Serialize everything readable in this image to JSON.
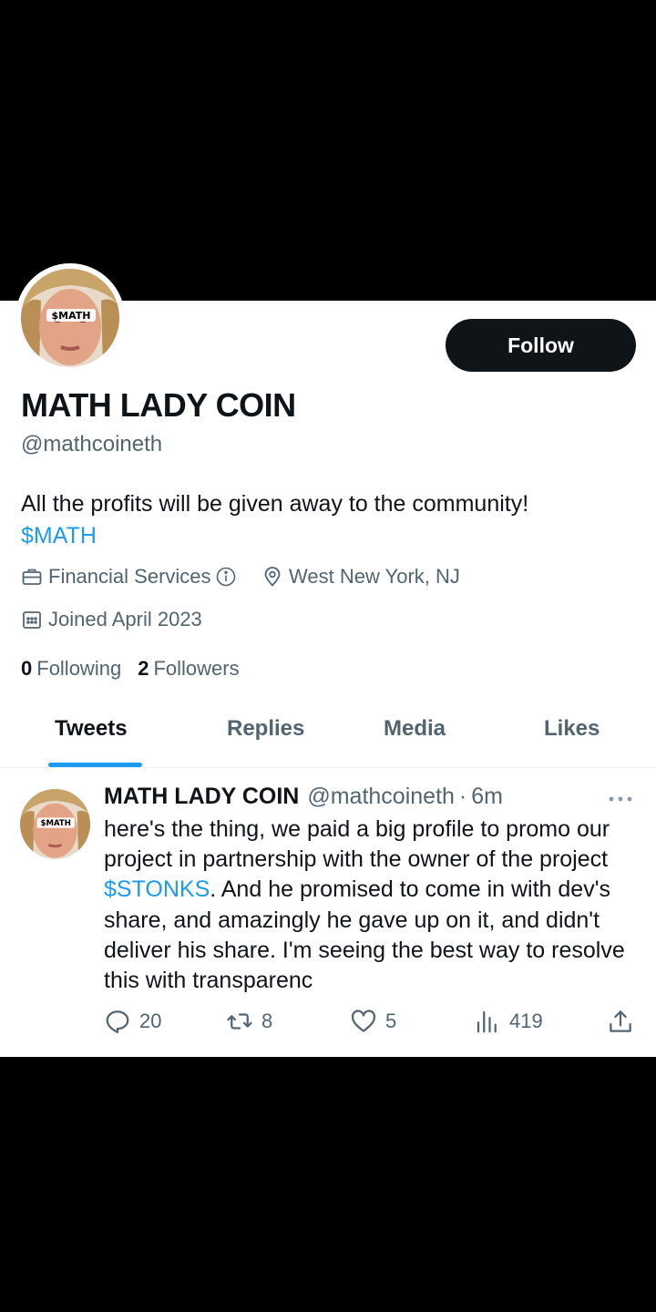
{
  "profile": {
    "display_name": "MATH LADY COIN",
    "handle": "@mathcoineth",
    "avatar_label": "$MATH",
    "follow_label": "Follow",
    "bio": "All the profits will be given away to the community!",
    "bio_tag": "$MATH",
    "category": "Financial Services",
    "location": "West New York, NJ",
    "joined": "Joined April 2023",
    "following_count": "0",
    "following_label": "Following",
    "followers_count": "2",
    "followers_label": "Followers"
  },
  "tabs": [
    {
      "label": "Tweets",
      "active": true
    },
    {
      "label": "Replies",
      "active": false
    },
    {
      "label": "Media",
      "active": false
    },
    {
      "label": "Likes",
      "active": false
    }
  ],
  "tweet": {
    "name": "MATH LADY COIN",
    "handle": "@mathcoineth",
    "dot": "·",
    "time": "6m",
    "avatar_label": "$MATH",
    "text_part1": "here's the thing, we paid a big profile to promo our project in partnership with the owner of the project ",
    "cashtag": "$STONKS",
    "text_part2": ".  And he promised to come in with dev's share, and amazingly he gave up on it, and didn't deliver his share.  I'm seeing the best way to resolve this with transparenc",
    "replies": "20",
    "retweets": "8",
    "likes": "5",
    "views": "419"
  },
  "icons": {
    "category": "briefcase-icon",
    "info": "info-icon",
    "location": "location-pin-icon",
    "joined": "calendar-icon",
    "more": "more-icon",
    "reply": "reply-icon",
    "retweet": "retweet-icon",
    "like": "heart-icon",
    "views": "views-icon",
    "share": "share-icon"
  },
  "colors": {
    "accent": "#1d9bf0",
    "text": "#0f1419",
    "secondary": "#536471",
    "button_bg": "#0f1419"
  }
}
